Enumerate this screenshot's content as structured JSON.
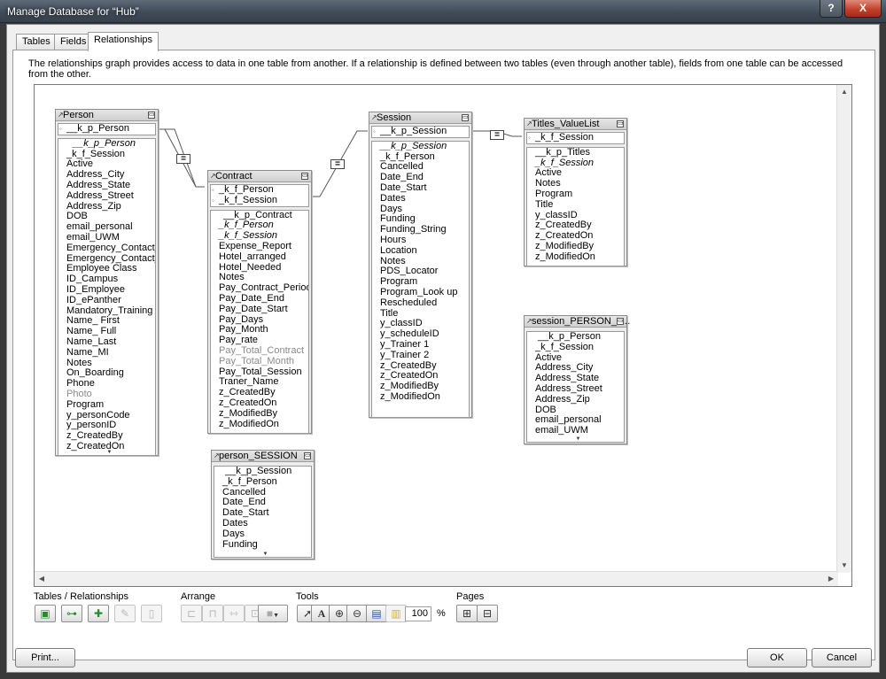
{
  "window": {
    "title": "Manage Database for “Hub”",
    "help_label": "?",
    "close_label": "X"
  },
  "tabs": [
    {
      "label": "Tables"
    },
    {
      "label": "Fields"
    },
    {
      "label": "Relationships"
    }
  ],
  "description": "The relationships graph provides access to data in one table from another. If a relationship is defined between two tables (even through another table), fields from one table can be accessed from the other.",
  "tables": {
    "person": {
      "name": "Person",
      "keys": [
        "__k_p_Person"
      ],
      "fields": [
        "__k_p_Person",
        "_k_f_Session",
        "Active",
        "Address_City",
        "Address_State",
        "Address_Street",
        "Address_Zip",
        "DOB",
        "email_personal",
        "email_UWM",
        "Emergency_Contact_...",
        "Emergency_Contact_...",
        "Employee Class",
        "ID_Campus",
        "ID_Employee",
        "ID_ePanther",
        "Mandatory_Training",
        "Name_ First",
        "Name_ Full",
        "Name_Last",
        "Name_MI",
        "Notes",
        "On_Boarding",
        "Phone",
        "Photo",
        "Program",
        "y_personCode",
        "y_personID",
        "z_CreatedBy",
        "z_CreatedOn"
      ]
    },
    "contract": {
      "name": "Contract",
      "keys": [
        "_k_f_Person",
        "_k_f_Session"
      ],
      "fields": [
        "__k_p_Contract",
        "_k_f_Person",
        "_k_f_Session",
        "Expense_Report",
        "Hotel_arranged",
        "Hotel_Needed",
        "Notes",
        "Pay_Contract_Period",
        "Pay_Date_End",
        "Pay_Date_Start",
        "Pay_Days",
        "Pay_Month",
        "Pay_rate",
        "Pay_Total_Contract",
        "Pay_Total_Month",
        "Pay_Total_Session",
        "Traner_Name",
        "z_CreatedBy",
        "z_CreatedOn",
        "z_ModifiedBy",
        "z_ModifiedOn"
      ]
    },
    "session": {
      "name": "Session",
      "keys": [
        "__k_p_Session"
      ],
      "fields": [
        "__k_p_Session",
        "_k_f_Person",
        "Cancelled",
        "Date_End",
        "Date_Start",
        "Dates",
        "Days",
        "Funding",
        "Funding_String",
        "Hours",
        "Location",
        "Notes",
        "PDS_Locator",
        "Program",
        "Program_Look up",
        "Rescheduled",
        "Title",
        "y_classID",
        "y_scheduleID",
        "y_Trainer 1",
        "y_Trainer 2",
        "z_CreatedBy",
        "z_CreatedOn",
        "z_ModifiedBy",
        "z_ModifiedOn"
      ]
    },
    "titles": {
      "name": "Titles_ValueList",
      "keys": [
        "_k_f_Session"
      ],
      "fields": [
        "__k_p_Titles",
        "_k_f_Session",
        "Active",
        "Notes",
        "Program",
        "Title",
        "y_classID",
        "z_CreatedBy",
        "z_CreatedOn",
        "z_ModifiedBy",
        "z_ModifiedOn"
      ]
    },
    "person_session": {
      "name": "person_SESSION",
      "fields": [
        "__k_p_Session",
        "_k_f_Person",
        "Cancelled",
        "Date_End",
        "Date_Start",
        "Dates",
        "Days",
        "Funding"
      ]
    },
    "session_person": {
      "name": "session_PERSON_tr...",
      "fields": [
        "__k_p_Person",
        "_k_f_Session",
        "Active",
        "Address_City",
        "Address_State",
        "Address_Street",
        "Address_Zip",
        "DOB",
        "email_personal",
        "email_UWM"
      ]
    }
  },
  "relationship_operator": "=",
  "toolbar": {
    "tables_relationships_label": "Tables / Relationships",
    "arrange_label": "Arrange",
    "tools_label": "Tools",
    "pages_label": "Pages",
    "zoom_value": "100",
    "zoom_unit": "%"
  },
  "buttons": {
    "print": "Print...",
    "ok": "OK",
    "cancel": "Cancel"
  }
}
